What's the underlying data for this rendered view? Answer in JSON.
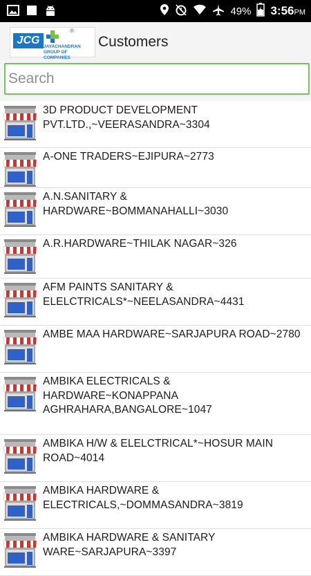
{
  "status_bar": {
    "battery": "49%",
    "time": "3:56",
    "ampm": "PM",
    "icons": [
      "image-icon",
      "square-icon",
      "android-icon",
      "location-icon",
      "alarm-icon",
      "wifi-icon",
      "airplane-icon",
      "battery-icon"
    ]
  },
  "app_bar": {
    "logo_text": "JCG",
    "logo_subtext": "JAYACHANDRAN GROUP OF COMPANIES",
    "logo_registered": "®",
    "title": "Customers"
  },
  "search": {
    "placeholder": "Search",
    "value": ""
  },
  "customers": [
    {
      "name": "3D PRODUCT DEVELOPMENT PVT.LTD.,~VEERASANDRA~3304"
    },
    {
      "name": "A-ONE TRADERS~EJIPURA~2773"
    },
    {
      "name": "A.N.SANITARY & HARDWARE~BOMMANAHALLI~3030"
    },
    {
      "name": "A.R.HARDWARE~THILAK NAGAR~326"
    },
    {
      "name": "AFM PAINTS SANITARY & ELELCTRICALS*~NEELASANDRA~4431"
    },
    {
      "name": "AMBE MAA HARDWARE~SARJAPURA ROAD~2780"
    },
    {
      "name": "AMBIKA ELECTRICALS & HARDWARE~KONAPPANA AGHRAHARA,BANGALORE~1047"
    },
    {
      "name": "AMBIKA H/W & ELELCTRICAL*~HOSUR MAIN ROAD~4014"
    },
    {
      "name": "AMBIKA HARDWARE & ELECTRICALS,~DOMMASANDRA~3819"
    },
    {
      "name": "AMBIKA HARDWARE & SANITARY WARE~SARJAPURA~3397"
    }
  ],
  "colors": {
    "status_bar_bg": "#000000",
    "app_bar_bg": "#f4f4f4",
    "search_border": "#74c35b",
    "logo_blue": "#1a76c8",
    "logo_green": "#7ac043",
    "store_awning_red": "#d9302c",
    "store_window_blue": "#2f62c9"
  }
}
